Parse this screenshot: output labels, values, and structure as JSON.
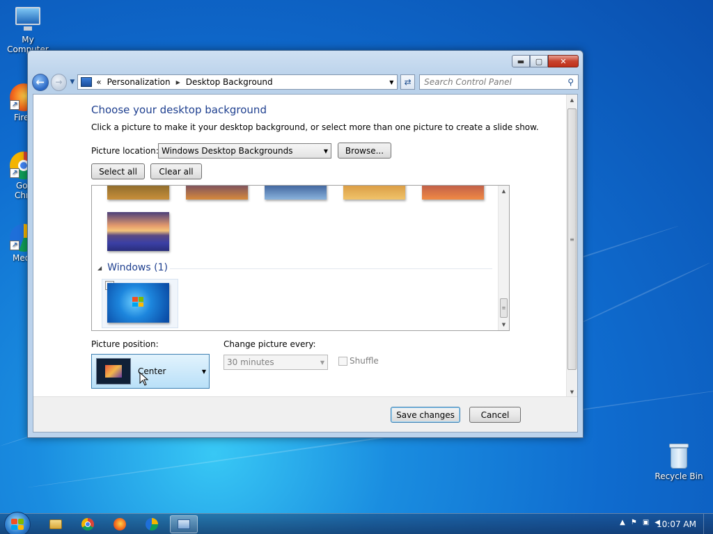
{
  "desktop": {
    "icons": [
      {
        "label": "My Computer"
      },
      {
        "label": "Fire"
      },
      {
        "label": "Goo Chro"
      },
      {
        "label": "Media"
      },
      {
        "label": "Recycle Bin"
      }
    ]
  },
  "window": {
    "controls": {
      "minimize": "▬",
      "maximize": "▢",
      "close": "✕"
    },
    "nav": {
      "back": "←",
      "forward": "→"
    },
    "address": {
      "prefix": "«",
      "crumbs": [
        "Personalization",
        "Desktop Background"
      ]
    },
    "search": {
      "placeholder": "Search Control Panel"
    },
    "page": {
      "title": "Choose your desktop background",
      "subtitle": "Click a picture to make it your desktop background, or select more than one picture to create a slide show.",
      "picture_location_label": "Picture location:",
      "picture_location_value": "Windows Desktop Backgrounds",
      "browse_label": "Browse...",
      "select_all_label": "Select all",
      "clear_all_label": "Clear all",
      "group_windows_label": "Windows (1)",
      "picture_position_label": "Picture position:",
      "picture_position_value": "Center",
      "change_picture_label": "Change picture every:",
      "change_picture_value": "30 minutes",
      "shuffle_label": "Shuffle",
      "save_label": "Save changes",
      "cancel_label": "Cancel"
    }
  },
  "taskbar": {
    "clock": "10:07 AM"
  }
}
